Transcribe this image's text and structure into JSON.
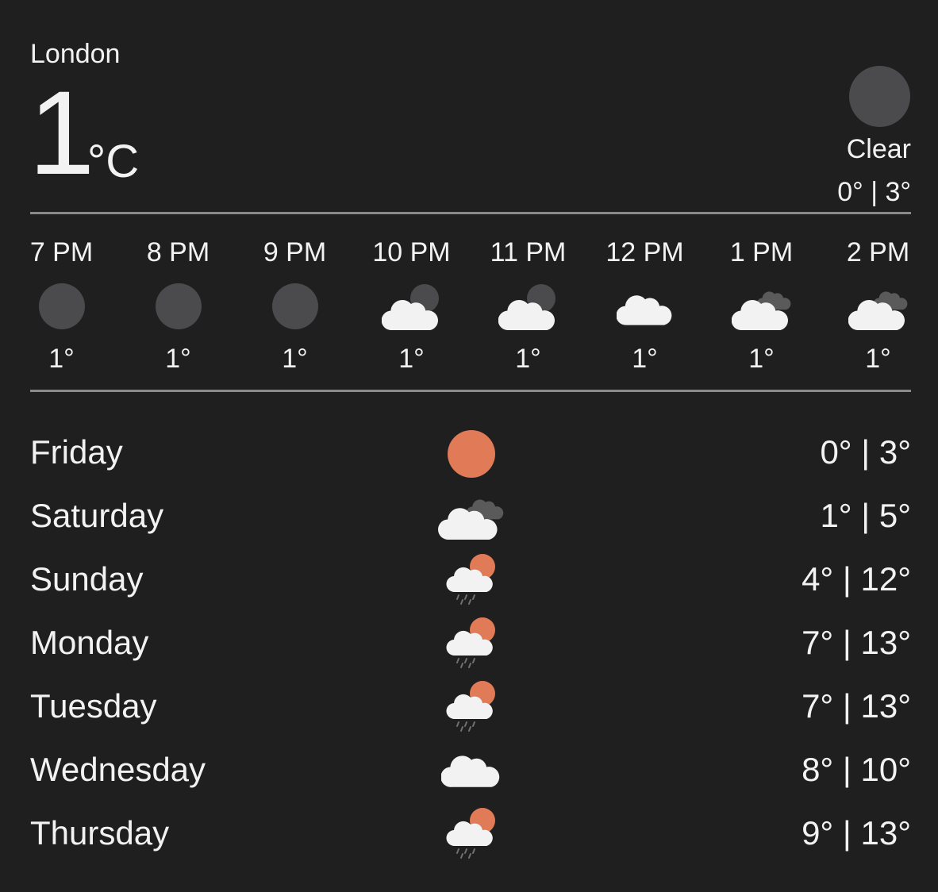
{
  "location": {
    "city": "London"
  },
  "current": {
    "temperature": "1",
    "unit": "°C",
    "condition": "Clear",
    "range": "0° | 3°",
    "icon": "moon-icon"
  },
  "colors": {
    "background": "#1f1f1f",
    "text": "#f2f2f2",
    "divider": "#8a8a8a",
    "moon": "#4b4b4e",
    "sun": "#e07a57",
    "cloud": "#f2f2f2",
    "dark_cloud": "#5a5a5a"
  },
  "hourly": [
    {
      "time": "7 PM",
      "temp": "1°",
      "icon": "moon-icon"
    },
    {
      "time": "8 PM",
      "temp": "1°",
      "icon": "moon-icon"
    },
    {
      "time": "9 PM",
      "temp": "1°",
      "icon": "moon-icon"
    },
    {
      "time": "10 PM",
      "temp": "1°",
      "icon": "cloud-moon-icon"
    },
    {
      "time": "11 PM",
      "temp": "1°",
      "icon": "cloud-moon-icon"
    },
    {
      "time": "12 PM",
      "temp": "1°",
      "icon": "cloud-icon"
    },
    {
      "time": "1 PM",
      "temp": "1°",
      "icon": "cloud-dark-cloud-icon"
    },
    {
      "time": "2 PM",
      "temp": "1°",
      "icon": "cloud-dark-cloud-icon"
    }
  ],
  "daily": [
    {
      "day": "Friday",
      "range": "0° | 3°",
      "icon": "sun-icon"
    },
    {
      "day": "Saturday",
      "range": "1° | 5°",
      "icon": "cloud-dark-cloud-icon"
    },
    {
      "day": "Sunday",
      "range": "4° | 12°",
      "icon": "sun-cloud-rain-icon"
    },
    {
      "day": "Monday",
      "range": "7° | 13°",
      "icon": "sun-cloud-rain-icon"
    },
    {
      "day": "Tuesday",
      "range": "7° | 13°",
      "icon": "sun-cloud-rain-icon"
    },
    {
      "day": "Wednesday",
      "range": "8° | 10°",
      "icon": "cloud-icon"
    },
    {
      "day": "Thursday",
      "range": "9° | 13°",
      "icon": "sun-cloud-rain-icon"
    }
  ]
}
